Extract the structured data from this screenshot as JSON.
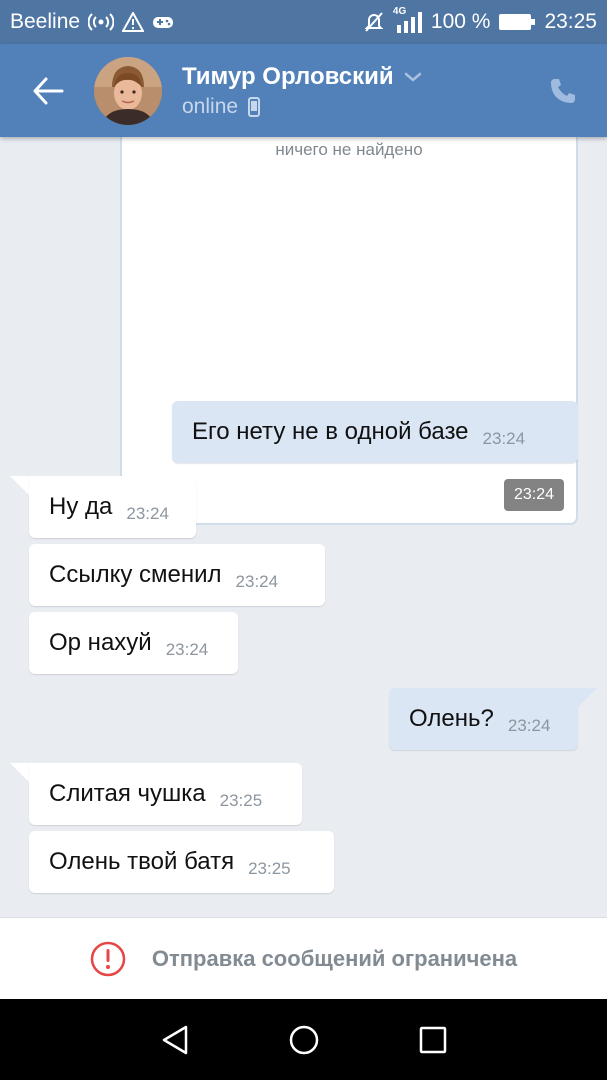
{
  "status_bar": {
    "carrier": "Beeline",
    "network": "4G",
    "battery": "100 %",
    "time": "23:25"
  },
  "header": {
    "contact_name": "Тимур Орловский",
    "contact_status": "online",
    "icons": [
      "back-arrow-icon",
      "chevron-down-icon",
      "mobile-device-icon",
      "phone-icon"
    ]
  },
  "search_card": {
    "empty_text": "ничего не найдено",
    "time": "23:24"
  },
  "messages": [
    {
      "direction": "out",
      "text": "Его нету не в одной базе",
      "time": "23:24"
    },
    {
      "direction": "in",
      "text": "Ну да",
      "time": "23:24"
    },
    {
      "direction": "in",
      "text": "Ссылку сменил",
      "time": "23:24"
    },
    {
      "direction": "in",
      "text": "Ор нахуй",
      "time": "23:24"
    },
    {
      "direction": "out",
      "text": "Олень?",
      "time": "23:24"
    },
    {
      "direction": "in",
      "text": "Слитая чушка",
      "time": "23:25"
    },
    {
      "direction": "in",
      "text": "Олень твой батя",
      "time": "23:25"
    }
  ],
  "restriction": {
    "text": "Отправка сообщений ограничена"
  },
  "colors": {
    "header": "#5181b8",
    "status_bar": "#4f75a3",
    "chat_bg": "#e9edf2",
    "outgoing_bubble": "#dbe6f4",
    "warning": "#e64646"
  }
}
